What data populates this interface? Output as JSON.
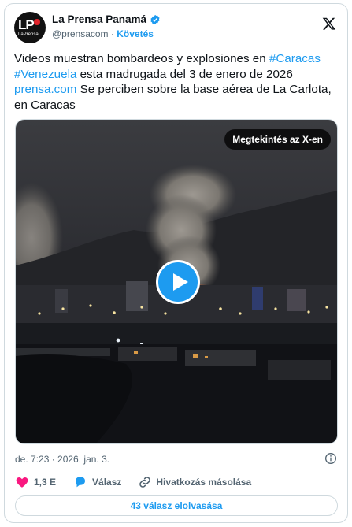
{
  "account": {
    "display_name": "La Prensa Panamá",
    "handle": "@prensacom",
    "separator": "·",
    "follow_label": "Követés",
    "avatar_text": "LP",
    "avatar_subtext": "LaPrensa"
  },
  "tweet": {
    "text_1": "Videos muestran bombardeos y explosiones en ",
    "hashtag_1": "#Caracas",
    "hashtag_2": "#Venezuela",
    "text_2": " esta madrugada del 3 de enero de 2026",
    "link": "prensa.com",
    "text_3": " Se perciben sobre la base aérea de La Carlota, en Caracas"
  },
  "media": {
    "view_on_x_label": "Megtekintés az X-en"
  },
  "meta": {
    "timestamp": "de. 7:23 · 2026. jan. 3."
  },
  "actions": {
    "likes_count": "1,3 E",
    "reply_label": "Válasz",
    "copy_link_label": "Hivatkozás másolása"
  },
  "read_replies_label": "43 válasz elolvasása",
  "colors": {
    "accent": "#1d9bf0",
    "like": "#f91880",
    "text": "#0f1419",
    "secondary": "#536471",
    "border": "#cfd9de"
  },
  "icons": [
    "verified-badge-icon",
    "x-logo-icon",
    "play-icon",
    "info-icon",
    "heart-icon",
    "reply-bubble-icon",
    "link-icon"
  ]
}
